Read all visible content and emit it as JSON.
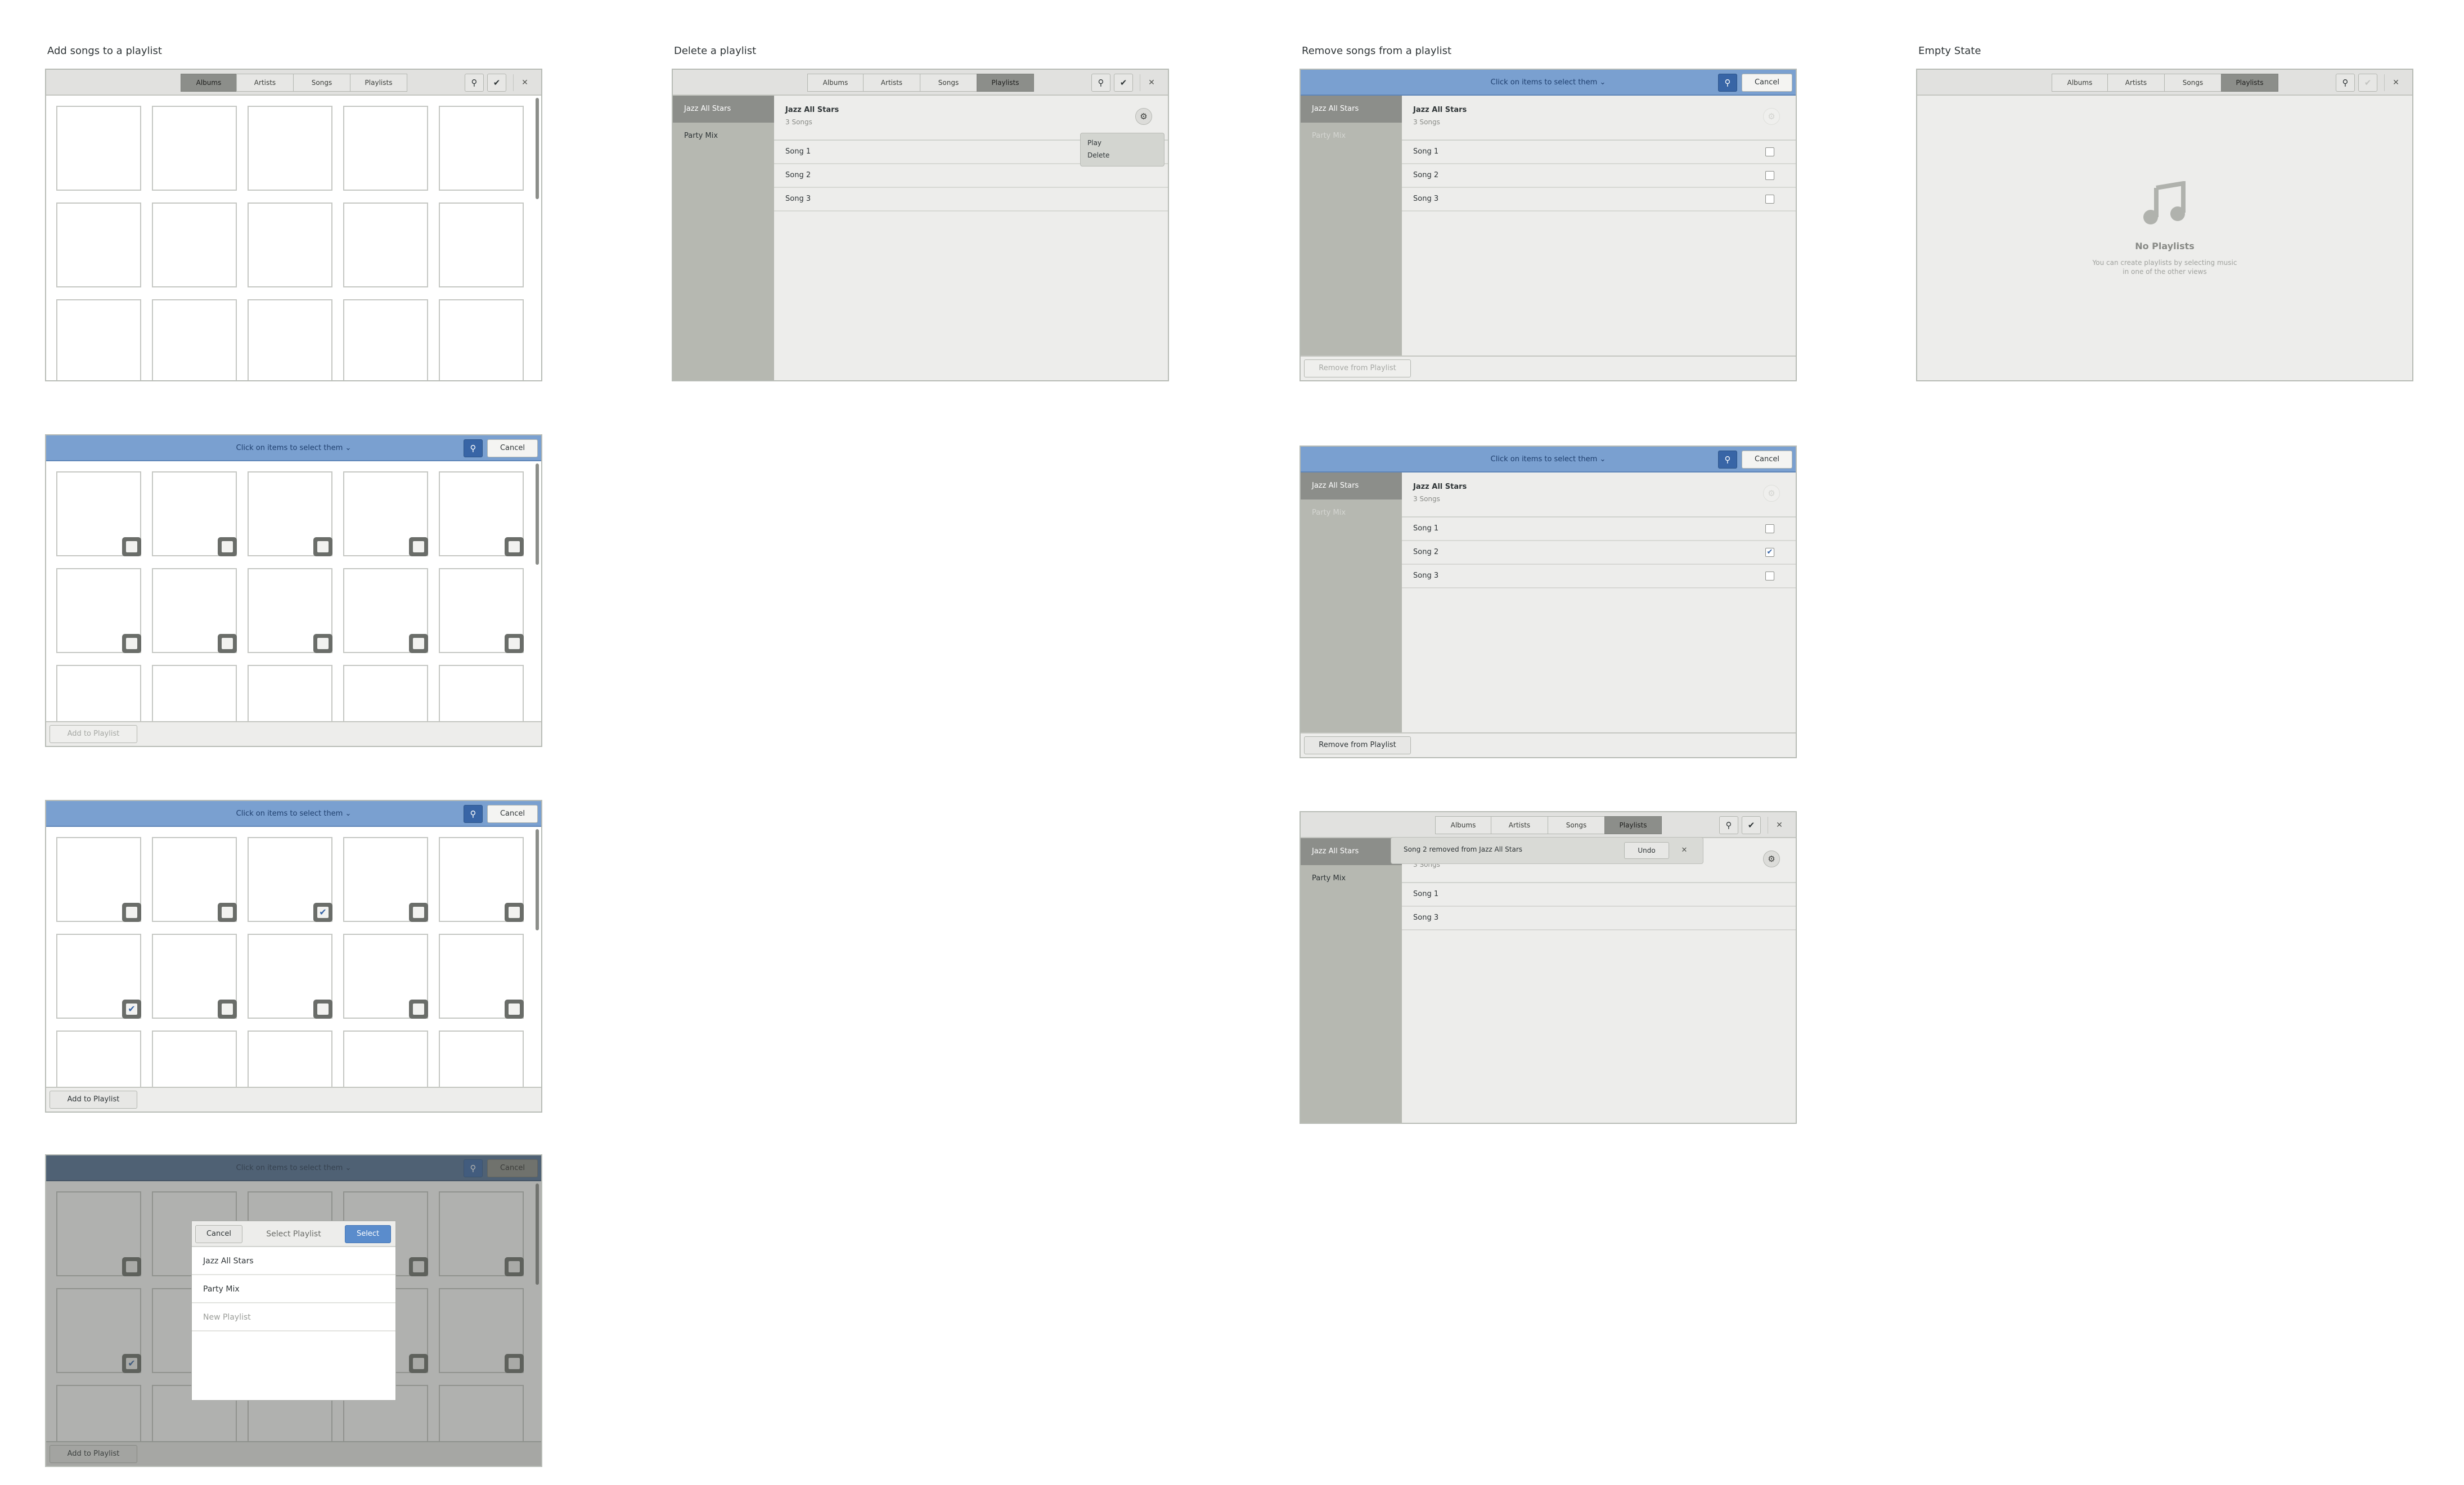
{
  "sections": {
    "add_songs": "Add songs to a playlist",
    "delete_playlist": "Delete a playlist",
    "remove_songs": "Remove songs from a playlist",
    "empty_state": "Empty State"
  },
  "tabs": [
    "Albums",
    "Artists",
    "Songs",
    "Playlists"
  ],
  "selection_title": "Click on items to select them",
  "cancel_label": "Cancel",
  "add_to_playlist_label": "Add to Playlist",
  "remove_from_playlist_label": "Remove from Playlist",
  "playlists": [
    "Jazz All Stars",
    "Party Mix"
  ],
  "playlist_detail": {
    "title": "Jazz All Stars",
    "count": "3 Songs",
    "songs": [
      "Song 1",
      "Song 2",
      "Song 3"
    ]
  },
  "songs_after_remove": [
    "Song 1",
    "Song 3"
  ],
  "menu": {
    "play": "Play",
    "delete": "Delete"
  },
  "empty": {
    "title": "No Playlists",
    "line1": "You can create playlists by selecting music",
    "line2": "in one of the other views"
  },
  "toast": {
    "message": "Song 2 removed from Jazz All Stars",
    "undo": "Undo"
  },
  "dialog": {
    "cancel": "Cancel",
    "title": "Select Playlist",
    "select": "Select",
    "items": [
      "Jazz All Stars",
      "Party Mix"
    ],
    "new_item": "New Playlist"
  },
  "icons": {
    "search": "search-icon",
    "check": "check-icon",
    "close": "close-icon",
    "gear": "gear-icon",
    "music": "music-note-icon",
    "chevron": "chevron-down-icon"
  },
  "colors": {
    "selection_header": "#7aa0d0",
    "accent": "#3865a6",
    "sidebar": "#b6b8b1",
    "active_tab": "#8c8e8a"
  }
}
